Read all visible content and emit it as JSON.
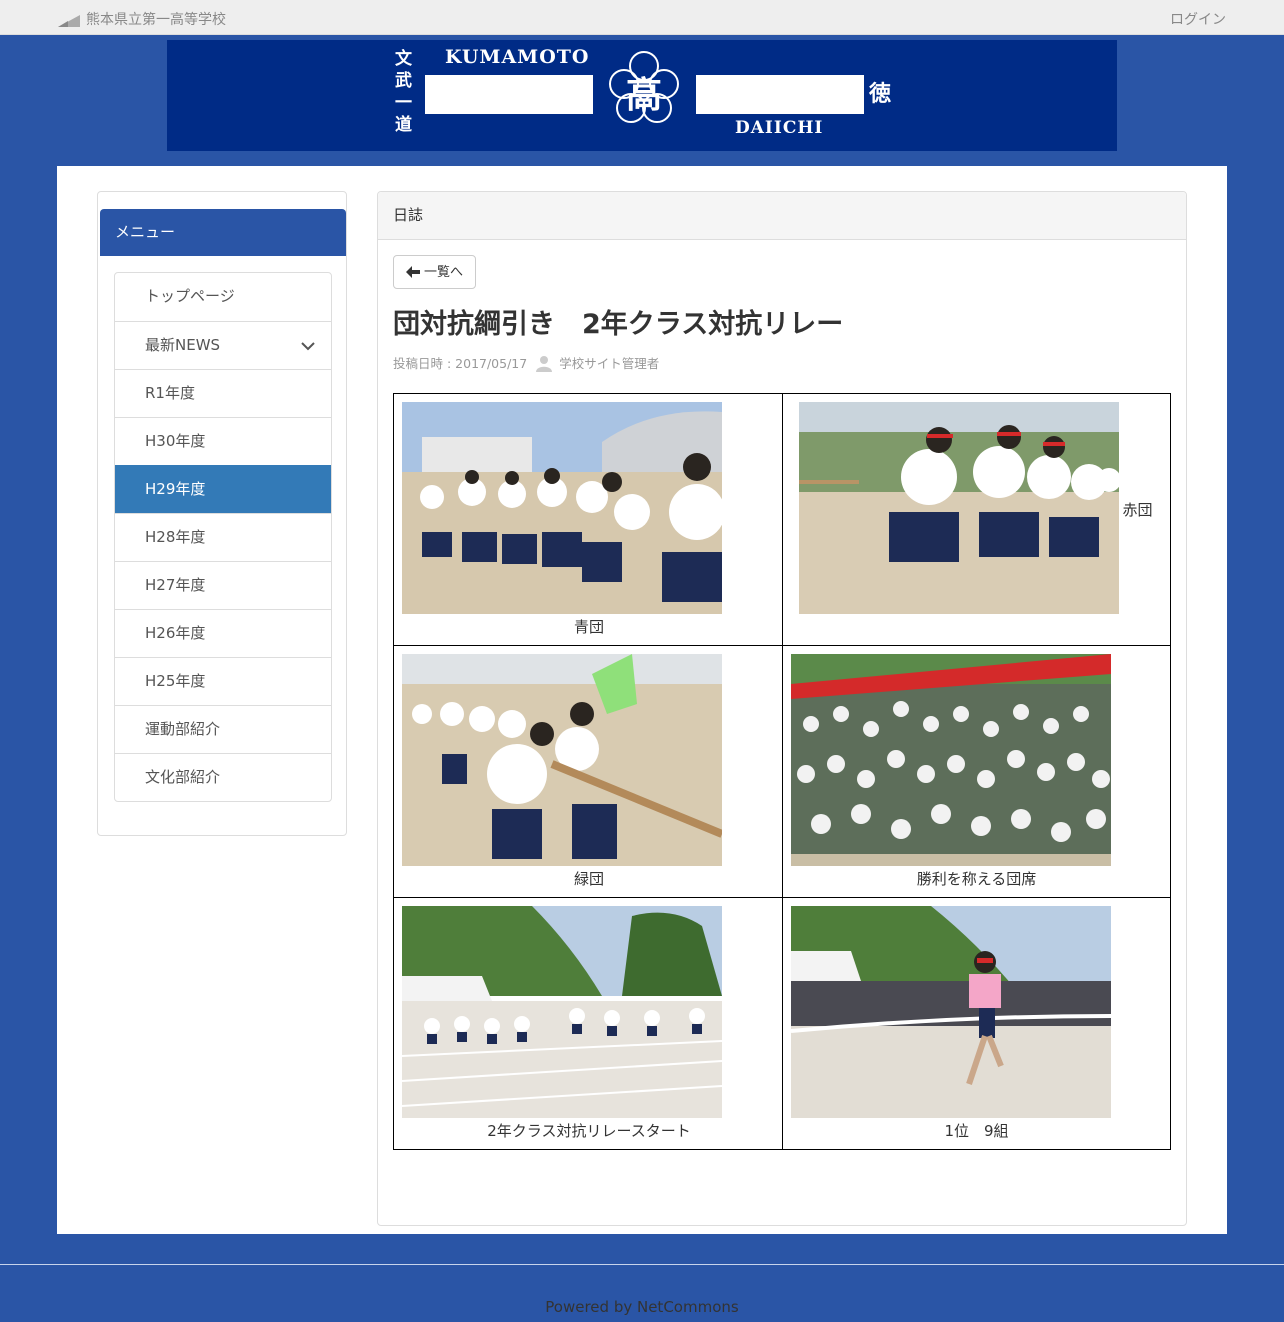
{
  "topbar": {
    "site_name": "熊本県立第一高等学校",
    "login": "ログイン"
  },
  "banner": {
    "vertical_left": "文武一道",
    "vertical_right": "徳",
    "kumamoto": "KUMAMOTO",
    "daiichi": "DAIICHI",
    "emblem_char": "高",
    "colors": {
      "background": "#002b86",
      "text": "#ffffff"
    }
  },
  "sidebar": {
    "header": "メニュー",
    "items": [
      {
        "label": "トップページ",
        "active": false,
        "has_children": false
      },
      {
        "label": "最新NEWS",
        "active": false,
        "has_children": true
      },
      {
        "label": "R1年度",
        "active": false,
        "has_children": false
      },
      {
        "label": "H30年度",
        "active": false,
        "has_children": false
      },
      {
        "label": "H29年度",
        "active": true,
        "has_children": false
      },
      {
        "label": "H28年度",
        "active": false,
        "has_children": false
      },
      {
        "label": "H27年度",
        "active": false,
        "has_children": false
      },
      {
        "label": "H26年度",
        "active": false,
        "has_children": false
      },
      {
        "label": "H25年度",
        "active": false,
        "has_children": false
      },
      {
        "label": "運動部紹介",
        "active": false,
        "has_children": false
      },
      {
        "label": "文化部紹介",
        "active": false,
        "has_children": false
      }
    ]
  },
  "content": {
    "header": "日誌",
    "back_button": "一覧へ",
    "title": "団対抗綱引き　2年クラス対抗リレー",
    "posted_label": "投稿日時 : 2017/05/17",
    "author": "学校サイト管理者",
    "photos": [
      {
        "caption": "青団",
        "caption_position": "below"
      },
      {
        "caption": "赤団",
        "caption_position": "right"
      },
      {
        "caption": "緑団",
        "caption_position": "below"
      },
      {
        "caption": "勝利を称える団席",
        "caption_position": "below"
      },
      {
        "caption": "2年クラス対抗リレースタート",
        "caption_position": "below"
      },
      {
        "caption": "1位　9組",
        "caption_position": "below"
      }
    ]
  },
  "footer": {
    "powered_by": "Powered by NetCommons"
  },
  "colors": {
    "page_background": "#2a55a6",
    "menu_header": "#2a55a6",
    "menu_active": "#337ab7"
  }
}
